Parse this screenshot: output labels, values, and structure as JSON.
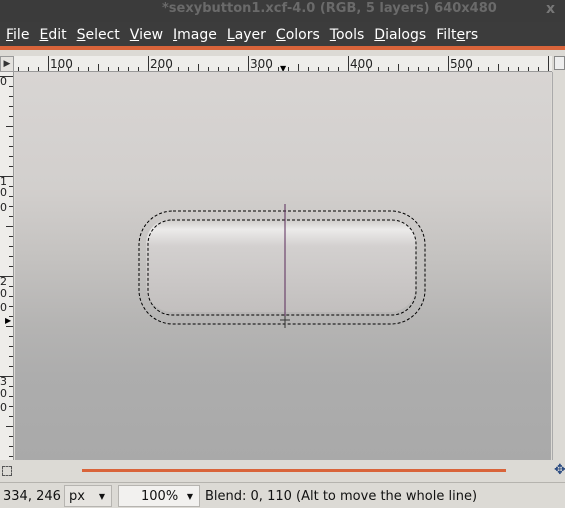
{
  "window": {
    "title": "*sexybutton1.xcf-4.0 (RGB, 5 layers) 640x480",
    "close_glyph": "x"
  },
  "menu": [
    {
      "u": "F",
      "rest": "ile"
    },
    {
      "u": "E",
      "rest": "dit"
    },
    {
      "u": "S",
      "rest": "elect"
    },
    {
      "u": "V",
      "rest": "iew"
    },
    {
      "u": "I",
      "rest": "mage"
    },
    {
      "u": "L",
      "rest": "ayer"
    },
    {
      "u": "C",
      "rest": "olors"
    },
    {
      "u": "T",
      "rest": "ools"
    },
    {
      "u": "D",
      "rest": "ialogs"
    },
    {
      "pre": "Filt",
      "u": "e",
      "rest": "rs"
    }
  ],
  "ruler": {
    "corner_glyph": "▶",
    "h_labels": [
      "100",
      "200",
      "300",
      "400",
      "500"
    ],
    "v_labels": [
      "0",
      "1",
      "0",
      "0",
      "2",
      "0",
      "0",
      "3",
      "0",
      "0"
    ]
  },
  "status": {
    "coords": "334, 246",
    "unit": "px",
    "zoom": "100%",
    "message": "Blend: 0, 110 (Alt to move the whole line)"
  },
  "colors": {
    "accent": "#d9643a",
    "titlebar": "#3b3b3b"
  },
  "icons": [
    "quick-mask-icon",
    "navigate-icon",
    "zoom-toggle-icon",
    "dropdown-arrow-icon"
  ]
}
